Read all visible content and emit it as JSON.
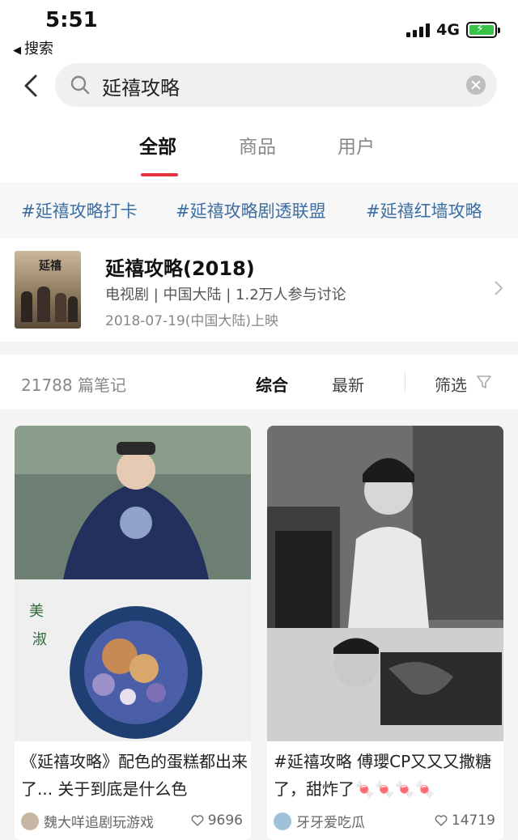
{
  "status_bar": {
    "time": "5:51",
    "back_app": "搜索",
    "network": "4G"
  },
  "search": {
    "query": "延禧攻略",
    "placeholder": ""
  },
  "tabs": [
    {
      "label": "全部",
      "active": true
    },
    {
      "label": "商品",
      "active": false
    },
    {
      "label": "用户",
      "active": false
    }
  ],
  "hashtags": [
    "#延禧攻略打卡",
    "#延禧攻略剧透联盟",
    "#延禧红墙攻略"
  ],
  "drama": {
    "title": "延禧攻略(2018)",
    "meta": "电视剧 | 中国大陆 | 1.2万人参与讨论",
    "release": "2018-07-19(中国大陆)上映"
  },
  "filter": {
    "count": "21788 篇笔记",
    "sort_options": [
      "综合",
      "最新"
    ],
    "active_sort": "综合",
    "filter_label": "筛选"
  },
  "notes": [
    {
      "caption": "《延禧攻略》配色的蛋糕都出来了... 关于到底是什么色",
      "author": "魏大咩追剧玩游戏",
      "likes": "9696"
    },
    {
      "caption": "#延禧攻略 傅瓔CP又又又撒糖了，甜炸了🍬🍬🍬🍬",
      "author": "牙牙爱吃瓜",
      "likes": "14719"
    }
  ],
  "colors": {
    "accent": "#e8313f",
    "hashtag": "#3d6ea1",
    "battery": "#39c24a"
  }
}
